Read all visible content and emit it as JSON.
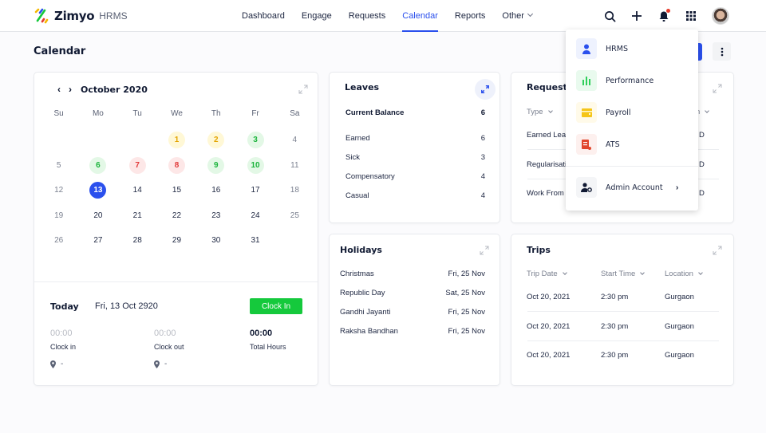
{
  "app": {
    "brand": "Zimyo",
    "product": "HRMS"
  },
  "nav": {
    "items": [
      {
        "label": "Dashboard",
        "active": false
      },
      {
        "label": "Engage",
        "active": false
      },
      {
        "label": "Requests",
        "active": false
      },
      {
        "label": "Calendar",
        "active": true
      },
      {
        "label": "Reports",
        "active": false
      },
      {
        "label": "Other",
        "active": false,
        "has_dropdown": true
      }
    ],
    "icons": [
      "search-icon",
      "plus-icon",
      "bell-icon",
      "apps-grid-icon",
      "avatar"
    ]
  },
  "page": {
    "title": "Calendar"
  },
  "colors": {
    "accent": "#2b50ed",
    "success": "#15c93c",
    "danger": "#e23b3b",
    "warning": "#e3a300"
  },
  "calendar": {
    "month_label": "October 2020",
    "weekdays": [
      "Su",
      "Mo",
      "Tu",
      "We",
      "Th",
      "Fr",
      "Sa"
    ],
    "weeks": [
      [
        {
          "d": ""
        },
        {
          "d": ""
        },
        {
          "d": ""
        },
        {
          "d": "1",
          "s": "yellow"
        },
        {
          "d": "2",
          "s": "yellow"
        },
        {
          "d": "3",
          "s": "green"
        },
        {
          "d": "4",
          "s": "weekend"
        }
      ],
      [
        {
          "d": "5",
          "s": "weekend"
        },
        {
          "d": "6",
          "s": "green"
        },
        {
          "d": "7",
          "s": "red"
        },
        {
          "d": "8",
          "s": "red"
        },
        {
          "d": "9",
          "s": "green"
        },
        {
          "d": "10",
          "s": "green"
        },
        {
          "d": "11",
          "s": "weekend"
        }
      ],
      [
        {
          "d": "12",
          "s": "weekend"
        },
        {
          "d": "13",
          "s": "today"
        },
        {
          "d": "14"
        },
        {
          "d": "15"
        },
        {
          "d": "16"
        },
        {
          "d": "17"
        },
        {
          "d": "18",
          "s": "weekend"
        }
      ],
      [
        {
          "d": "19",
          "s": "weekend"
        },
        {
          "d": "20"
        },
        {
          "d": "21"
        },
        {
          "d": "22"
        },
        {
          "d": "23"
        },
        {
          "d": "24"
        },
        {
          "d": "25",
          "s": "weekend"
        }
      ],
      [
        {
          "d": "26",
          "s": "weekend"
        },
        {
          "d": "27"
        },
        {
          "d": "28"
        },
        {
          "d": "29"
        },
        {
          "d": "30"
        },
        {
          "d": "31"
        },
        {
          "d": ""
        }
      ]
    ],
    "today": {
      "label": "Today",
      "date": "Fri, 13 Oct 2920",
      "clock_in_button": "Clock In",
      "clock_in": {
        "value": "00:00",
        "label": "Clock in",
        "location": "-"
      },
      "clock_out": {
        "value": "00:00",
        "label": "Clock out",
        "location": "-"
      },
      "total": {
        "value": "00:00",
        "label": "Total Hours"
      }
    }
  },
  "leaves": {
    "title": "Leaves",
    "current_balance": {
      "label": "Current Balance",
      "value": "6"
    },
    "items": [
      {
        "label": "Earned",
        "value": "6"
      },
      {
        "label": "Sick",
        "value": "3"
      },
      {
        "label": "Compensatory",
        "value": "4"
      },
      {
        "label": "Casual",
        "value": "4"
      }
    ]
  },
  "holidays": {
    "title": "Holidays",
    "items": [
      {
        "name": "Christmas",
        "date": "Fri, 25 Nov"
      },
      {
        "name": "Republic Day",
        "date": "Sat, 25 Nov"
      },
      {
        "name": "Gandhi Jayanti",
        "date": "Fri, 25 Nov"
      },
      {
        "name": "Raksha Bandhan",
        "date": "Fri, 25 Nov"
      }
    ]
  },
  "requests": {
    "title": "Requests",
    "columns": [
      "Type",
      "n"
    ],
    "rows": [
      {
        "type": "Earned Leav",
        "status": "D"
      },
      {
        "type": "Regularisati",
        "status": "D"
      },
      {
        "type": "Work From",
        "status": "D"
      }
    ]
  },
  "trips": {
    "title": "Trips",
    "columns": [
      "Trip Date",
      "Start Time",
      "Location"
    ],
    "rows": [
      {
        "date": "Oct 20, 2021",
        "time": "2:30 pm",
        "location": "Gurgaon"
      },
      {
        "date": "Oct 20, 2021",
        "time": "2:30 pm",
        "location": "Gurgaon"
      },
      {
        "date": "Oct 20, 2021",
        "time": "2:30 pm",
        "location": "Gurgaon"
      }
    ]
  },
  "apps_menu": {
    "items": [
      {
        "label": "HRMS",
        "icon": "user-icon"
      },
      {
        "label": "Performance",
        "icon": "bar-chart-icon"
      },
      {
        "label": "Payroll",
        "icon": "wallet-icon"
      },
      {
        "label": "ATS",
        "icon": "document-icon"
      }
    ],
    "admin": {
      "label": "Admin Account",
      "icon": "user-settings-icon"
    }
  }
}
